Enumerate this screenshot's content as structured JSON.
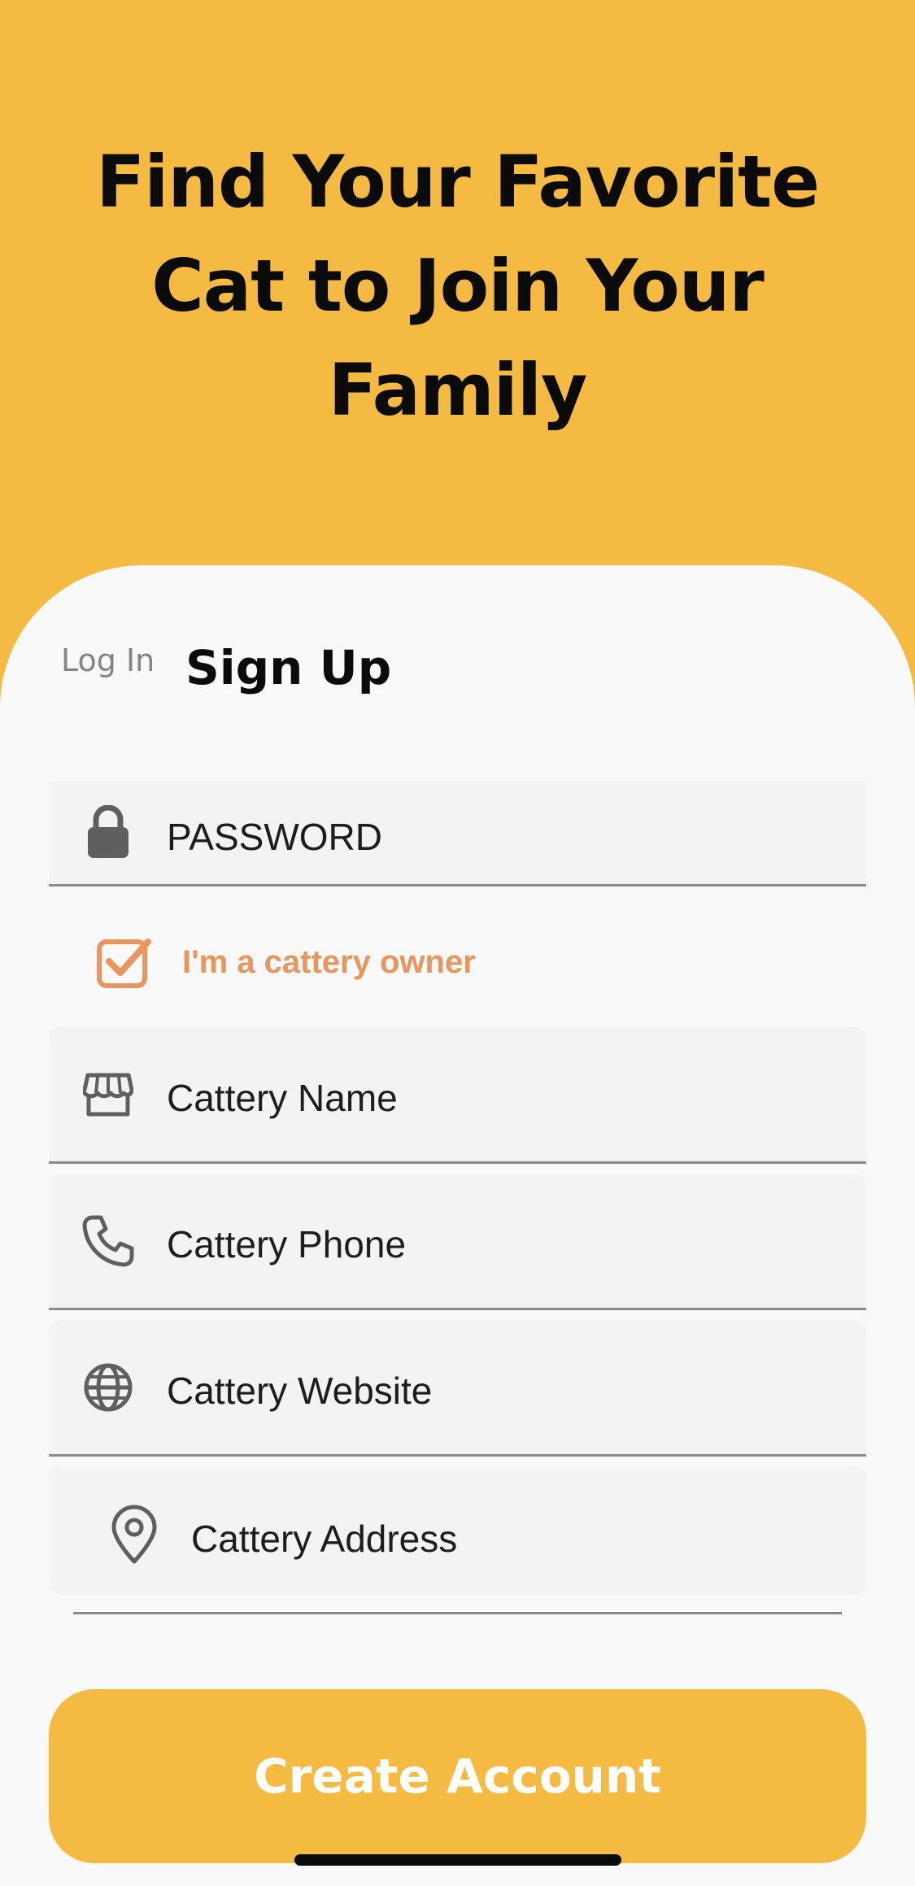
{
  "header": {
    "title_line1": "Find Your Favorite",
    "title_line2": "Cat to Join Your",
    "title_line3": "Family"
  },
  "tabs": {
    "login": "Log In",
    "signup": "Sign Up",
    "active": "signup"
  },
  "form": {
    "password": {
      "placeholder": "PASSWORD",
      "icon": "lock-icon"
    },
    "cattery_owner": {
      "label": "I'm a cattery owner",
      "checked": true
    },
    "cattery_name": {
      "placeholder": "Cattery Name",
      "icon": "storefront-icon"
    },
    "cattery_phone": {
      "placeholder": "Cattery Phone",
      "icon": "phone-icon"
    },
    "cattery_website": {
      "placeholder": "Cattery Website",
      "icon": "globe-icon"
    },
    "cattery_address": {
      "placeholder": "Cattery Address",
      "icon": "map-pin-icon"
    }
  },
  "actions": {
    "create_account": "Create Account"
  },
  "colors": {
    "brand": "#F4BA42",
    "accent": "#E8955E",
    "sheet": "#F9F9F9",
    "field": "#F3F3F3"
  }
}
